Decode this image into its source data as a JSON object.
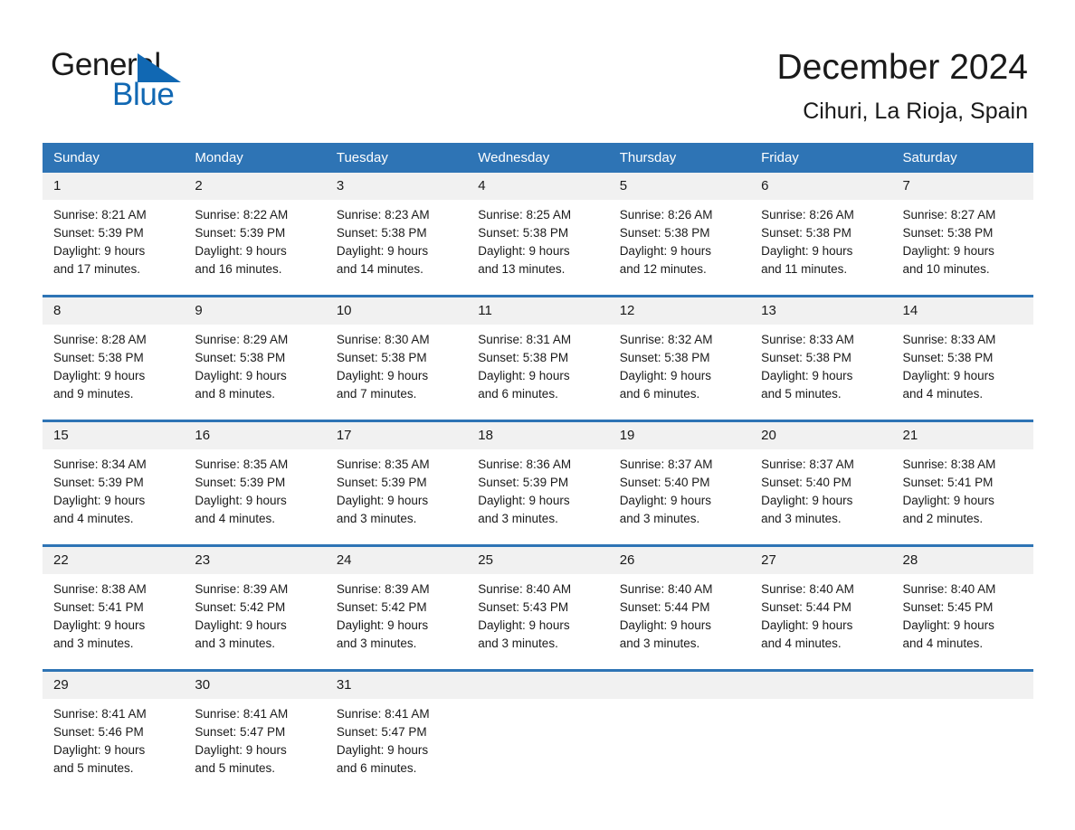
{
  "brand": {
    "name_part1": "General",
    "name_part2": "Blue",
    "triangle_color": "#1168b3",
    "text_color": "#1a1a1a"
  },
  "header": {
    "title": "December 2024",
    "subtitle": "Cihuri, La Rioja, Spain"
  },
  "theme": {
    "header_blue": "#2e74b5",
    "daynum_band": "#f1f1f1",
    "page_background": "#ffffff",
    "text": "#1a1a1a"
  },
  "weekday_headers": [
    "Sunday",
    "Monday",
    "Tuesday",
    "Wednesday",
    "Thursday",
    "Friday",
    "Saturday"
  ],
  "weeks": [
    [
      {
        "day": "1",
        "sunrise": "Sunrise: 8:21 AM",
        "sunset": "Sunset: 5:39 PM",
        "daylight_line1": "Daylight: 9 hours",
        "daylight_line2": "and 17 minutes."
      },
      {
        "day": "2",
        "sunrise": "Sunrise: 8:22 AM",
        "sunset": "Sunset: 5:39 PM",
        "daylight_line1": "Daylight: 9 hours",
        "daylight_line2": "and 16 minutes."
      },
      {
        "day": "3",
        "sunrise": "Sunrise: 8:23 AM",
        "sunset": "Sunset: 5:38 PM",
        "daylight_line1": "Daylight: 9 hours",
        "daylight_line2": "and 14 minutes."
      },
      {
        "day": "4",
        "sunrise": "Sunrise: 8:25 AM",
        "sunset": "Sunset: 5:38 PM",
        "daylight_line1": "Daylight: 9 hours",
        "daylight_line2": "and 13 minutes."
      },
      {
        "day": "5",
        "sunrise": "Sunrise: 8:26 AM",
        "sunset": "Sunset: 5:38 PM",
        "daylight_line1": "Daylight: 9 hours",
        "daylight_line2": "and 12 minutes."
      },
      {
        "day": "6",
        "sunrise": "Sunrise: 8:26 AM",
        "sunset": "Sunset: 5:38 PM",
        "daylight_line1": "Daylight: 9 hours",
        "daylight_line2": "and 11 minutes."
      },
      {
        "day": "7",
        "sunrise": "Sunrise: 8:27 AM",
        "sunset": "Sunset: 5:38 PM",
        "daylight_line1": "Daylight: 9 hours",
        "daylight_line2": "and 10 minutes."
      }
    ],
    [
      {
        "day": "8",
        "sunrise": "Sunrise: 8:28 AM",
        "sunset": "Sunset: 5:38 PM",
        "daylight_line1": "Daylight: 9 hours",
        "daylight_line2": "and 9 minutes."
      },
      {
        "day": "9",
        "sunrise": "Sunrise: 8:29 AM",
        "sunset": "Sunset: 5:38 PM",
        "daylight_line1": "Daylight: 9 hours",
        "daylight_line2": "and 8 minutes."
      },
      {
        "day": "10",
        "sunrise": "Sunrise: 8:30 AM",
        "sunset": "Sunset: 5:38 PM",
        "daylight_line1": "Daylight: 9 hours",
        "daylight_line2": "and 7 minutes."
      },
      {
        "day": "11",
        "sunrise": "Sunrise: 8:31 AM",
        "sunset": "Sunset: 5:38 PM",
        "daylight_line1": "Daylight: 9 hours",
        "daylight_line2": "and 6 minutes."
      },
      {
        "day": "12",
        "sunrise": "Sunrise: 8:32 AM",
        "sunset": "Sunset: 5:38 PM",
        "daylight_line1": "Daylight: 9 hours",
        "daylight_line2": "and 6 minutes."
      },
      {
        "day": "13",
        "sunrise": "Sunrise: 8:33 AM",
        "sunset": "Sunset: 5:38 PM",
        "daylight_line1": "Daylight: 9 hours",
        "daylight_line2": "and 5 minutes."
      },
      {
        "day": "14",
        "sunrise": "Sunrise: 8:33 AM",
        "sunset": "Sunset: 5:38 PM",
        "daylight_line1": "Daylight: 9 hours",
        "daylight_line2": "and 4 minutes."
      }
    ],
    [
      {
        "day": "15",
        "sunrise": "Sunrise: 8:34 AM",
        "sunset": "Sunset: 5:39 PM",
        "daylight_line1": "Daylight: 9 hours",
        "daylight_line2": "and 4 minutes."
      },
      {
        "day": "16",
        "sunrise": "Sunrise: 8:35 AM",
        "sunset": "Sunset: 5:39 PM",
        "daylight_line1": "Daylight: 9 hours",
        "daylight_line2": "and 4 minutes."
      },
      {
        "day": "17",
        "sunrise": "Sunrise: 8:35 AM",
        "sunset": "Sunset: 5:39 PM",
        "daylight_line1": "Daylight: 9 hours",
        "daylight_line2": "and 3 minutes."
      },
      {
        "day": "18",
        "sunrise": "Sunrise: 8:36 AM",
        "sunset": "Sunset: 5:39 PM",
        "daylight_line1": "Daylight: 9 hours",
        "daylight_line2": "and 3 minutes."
      },
      {
        "day": "19",
        "sunrise": "Sunrise: 8:37 AM",
        "sunset": "Sunset: 5:40 PM",
        "daylight_line1": "Daylight: 9 hours",
        "daylight_line2": "and 3 minutes."
      },
      {
        "day": "20",
        "sunrise": "Sunrise: 8:37 AM",
        "sunset": "Sunset: 5:40 PM",
        "daylight_line1": "Daylight: 9 hours",
        "daylight_line2": "and 3 minutes."
      },
      {
        "day": "21",
        "sunrise": "Sunrise: 8:38 AM",
        "sunset": "Sunset: 5:41 PM",
        "daylight_line1": "Daylight: 9 hours",
        "daylight_line2": "and 2 minutes."
      }
    ],
    [
      {
        "day": "22",
        "sunrise": "Sunrise: 8:38 AM",
        "sunset": "Sunset: 5:41 PM",
        "daylight_line1": "Daylight: 9 hours",
        "daylight_line2": "and 3 minutes."
      },
      {
        "day": "23",
        "sunrise": "Sunrise: 8:39 AM",
        "sunset": "Sunset: 5:42 PM",
        "daylight_line1": "Daylight: 9 hours",
        "daylight_line2": "and 3 minutes."
      },
      {
        "day": "24",
        "sunrise": "Sunrise: 8:39 AM",
        "sunset": "Sunset: 5:42 PM",
        "daylight_line1": "Daylight: 9 hours",
        "daylight_line2": "and 3 minutes."
      },
      {
        "day": "25",
        "sunrise": "Sunrise: 8:40 AM",
        "sunset": "Sunset: 5:43 PM",
        "daylight_line1": "Daylight: 9 hours",
        "daylight_line2": "and 3 minutes."
      },
      {
        "day": "26",
        "sunrise": "Sunrise: 8:40 AM",
        "sunset": "Sunset: 5:44 PM",
        "daylight_line1": "Daylight: 9 hours",
        "daylight_line2": "and 3 minutes."
      },
      {
        "day": "27",
        "sunrise": "Sunrise: 8:40 AM",
        "sunset": "Sunset: 5:44 PM",
        "daylight_line1": "Daylight: 9 hours",
        "daylight_line2": "and 4 minutes."
      },
      {
        "day": "28",
        "sunrise": "Sunrise: 8:40 AM",
        "sunset": "Sunset: 5:45 PM",
        "daylight_line1": "Daylight: 9 hours",
        "daylight_line2": "and 4 minutes."
      }
    ],
    [
      {
        "day": "29",
        "sunrise": "Sunrise: 8:41 AM",
        "sunset": "Sunset: 5:46 PM",
        "daylight_line1": "Daylight: 9 hours",
        "daylight_line2": "and 5 minutes."
      },
      {
        "day": "30",
        "sunrise": "Sunrise: 8:41 AM",
        "sunset": "Sunset: 5:47 PM",
        "daylight_line1": "Daylight: 9 hours",
        "daylight_line2": "and 5 minutes."
      },
      {
        "day": "31",
        "sunrise": "Sunrise: 8:41 AM",
        "sunset": "Sunset: 5:47 PM",
        "daylight_line1": "Daylight: 9 hours",
        "daylight_line2": "and 6 minutes."
      },
      {
        "day": "",
        "sunrise": "",
        "sunset": "",
        "daylight_line1": "",
        "daylight_line2": ""
      },
      {
        "day": "",
        "sunrise": "",
        "sunset": "",
        "daylight_line1": "",
        "daylight_line2": ""
      },
      {
        "day": "",
        "sunrise": "",
        "sunset": "",
        "daylight_line1": "",
        "daylight_line2": ""
      },
      {
        "day": "",
        "sunrise": "",
        "sunset": "",
        "daylight_line1": "",
        "daylight_line2": ""
      }
    ]
  ]
}
